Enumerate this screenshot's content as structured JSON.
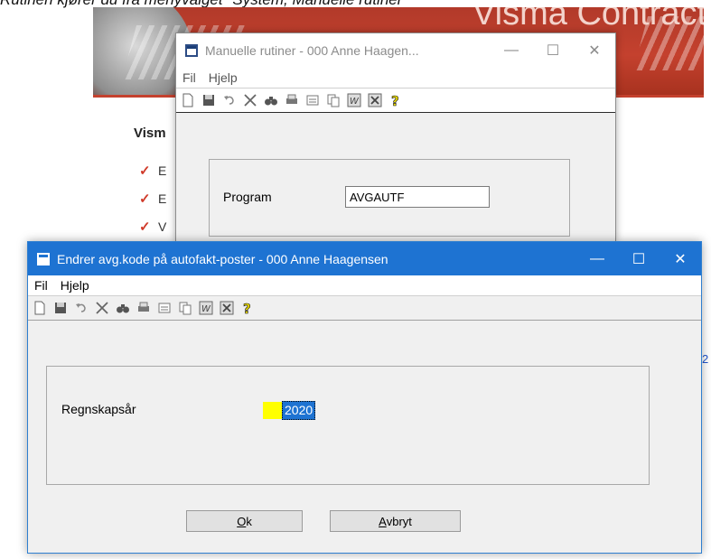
{
  "caption": "Rutinen kjører du fra menyvalget \"System, Manuelle rutiner\"",
  "background_page": {
    "brand_title": "Visma Contracting",
    "heading": "Vism",
    "bullets": [
      "E",
      "E",
      "V"
    ],
    "edge_text": "2"
  },
  "window_back": {
    "title": "Manuelle rutiner - 000 Anne Haagen...",
    "menu": [
      "Fil",
      "Hjelp"
    ],
    "program_label": "Program",
    "program_value": "AVGAUTF"
  },
  "window_front": {
    "title": "Endrer avg.kode på autofakt-poster - 000 Anne Haagensen",
    "menu": [
      "Fil",
      "Hjelp"
    ],
    "year_label": "Regnskapsår",
    "year_value": "2020",
    "ok_label": "Ok",
    "ok_key": "O",
    "ok_rest": "k",
    "cancel_key": "A",
    "cancel_rest": "vbryt"
  },
  "titlebar_controls": {
    "minimize": "—",
    "maximize": "☐",
    "close": "✕"
  },
  "toolbar_icons": [
    "new-document-icon",
    "save-icon",
    "undo-icon",
    "delete-icon",
    "find-icon",
    "print-icon",
    "form-icon",
    "copy-icon",
    "word-export-icon",
    "excel-export-icon",
    "help-icon"
  ],
  "colors": {
    "titlebar_active": "#1e73d2",
    "brand_red": "#c4412e",
    "selection_yellow": "#ffff00"
  }
}
